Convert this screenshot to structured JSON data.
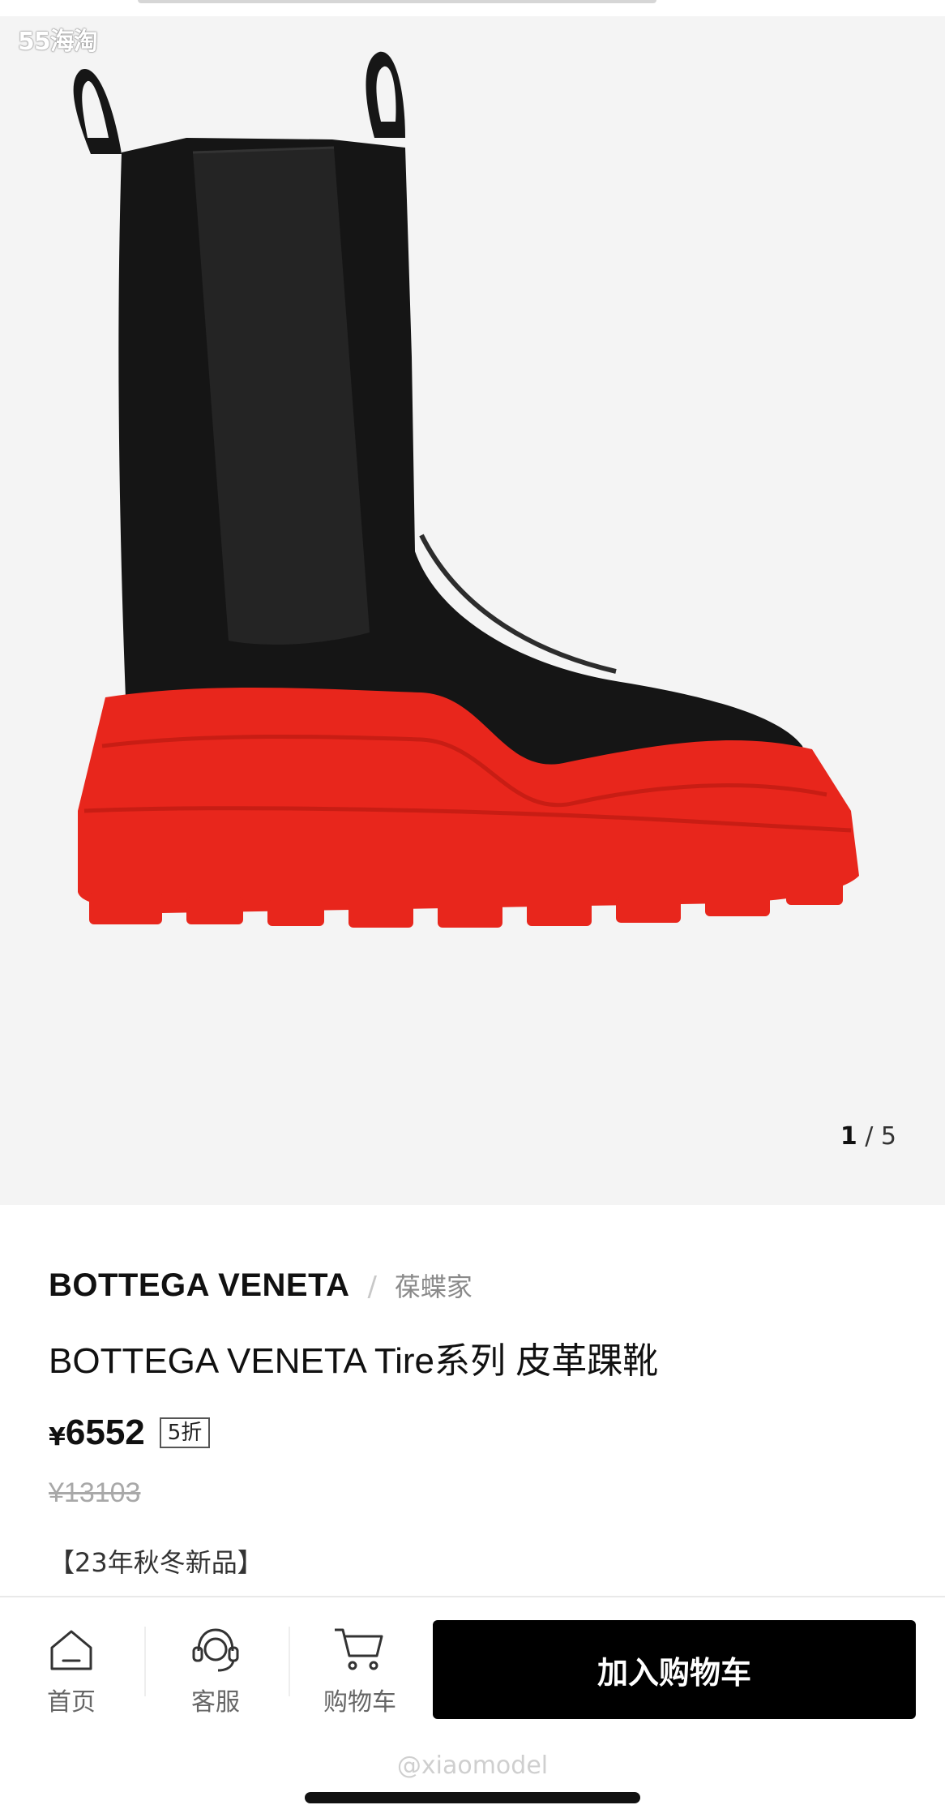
{
  "watermark_top": "55海淘",
  "gallery": {
    "current": "1",
    "total": "/ 5"
  },
  "product": {
    "brand": "BOTTEGA VENETA",
    "separator": "/",
    "store": "葆蝶家",
    "title": "BOTTEGA VENETA Tire系列 皮革踝靴",
    "currency": "¥",
    "price": "6552",
    "discount": "5折",
    "original_price": "¥13103",
    "tag": "【23年秋冬新品】"
  },
  "bottom_nav": {
    "home": {
      "label": "首页",
      "icon": "home-icon"
    },
    "service": {
      "label": "客服",
      "icon": "headset-icon"
    },
    "cart": {
      "label": "购物车",
      "icon": "cart-icon"
    },
    "add_to_cart": "加入购物车"
  },
  "watermark_bottom": "@xiaomodel",
  "colors": {
    "boot_upper": "#151515",
    "sole": "#e8261c",
    "button": "#000000",
    "background": "#f4f4f4"
  }
}
